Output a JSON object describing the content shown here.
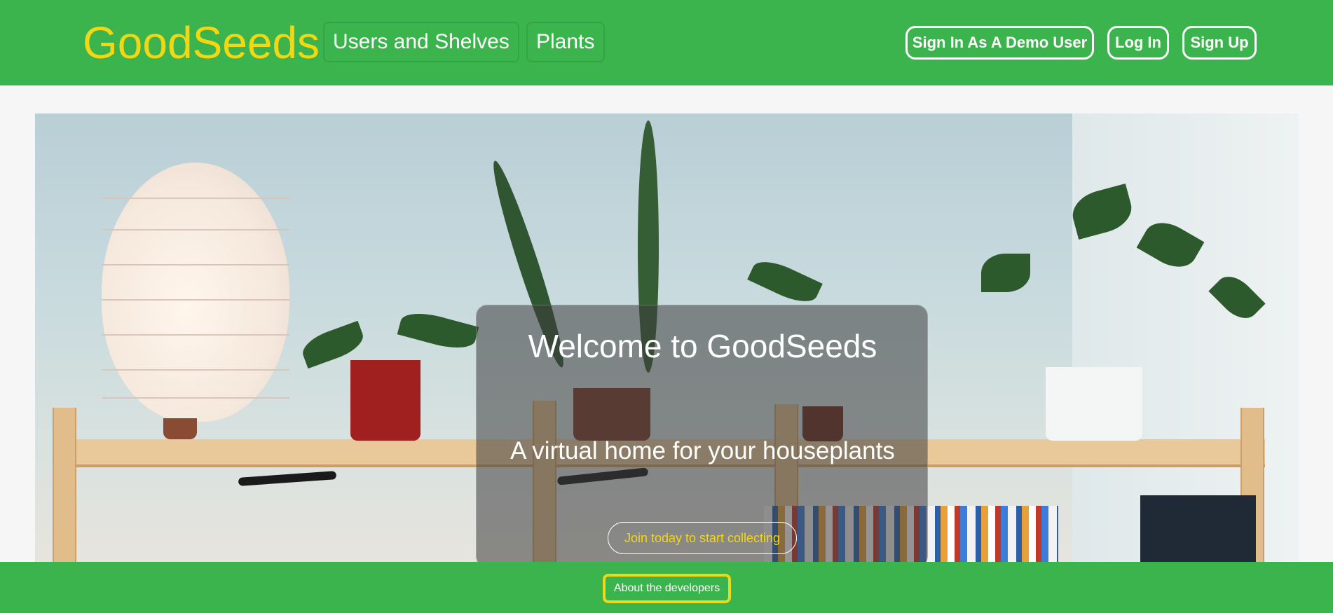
{
  "header": {
    "logo": "GoodSeeds",
    "nav": [
      {
        "label": "Users and Shelves"
      },
      {
        "label": "Plants"
      }
    ],
    "auth": {
      "demo_label": "Sign In As A Demo User",
      "login_label": "Log In",
      "signup_label": "Sign Up"
    }
  },
  "hero": {
    "title": "Welcome to GoodSeeds",
    "subtitle": "A virtual home for your houseplants",
    "cta_label": "Join today to start collecting"
  },
  "footer": {
    "about_label": "About the developers"
  },
  "colors": {
    "brand_green": "#3cb44e",
    "accent_yellow": "#f4d713",
    "text_white": "#ffffff"
  }
}
